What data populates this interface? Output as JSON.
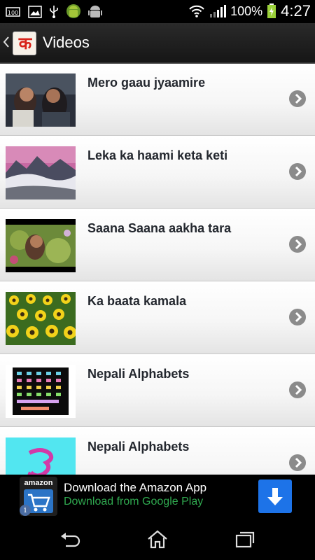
{
  "status_bar": {
    "battery_percent": "100%",
    "time": "4:27",
    "notification_icons": [
      "battery-100-icon",
      "image-icon",
      "usb-icon",
      "android-robot-icon",
      "android-debug-icon"
    ]
  },
  "action_bar": {
    "logo_char": "क",
    "title": "Videos"
  },
  "videos": [
    {
      "title": "Mero gaau jyaamire"
    },
    {
      "title": "Leka ka haami keta keti"
    },
    {
      "title": "Saana Saana aakha tara"
    },
    {
      "title": "Ka baata kamala"
    },
    {
      "title": "Nepali Alphabets"
    },
    {
      "title": "Nepali Alphabets"
    }
  ],
  "ad": {
    "brand": "amazon",
    "title": "Download the Amazon App",
    "subtitle": "Download from Google Play",
    "info": "i"
  },
  "colors": {
    "accent_green": "#2fa84f",
    "download_blue": "#1d73e8",
    "chevron_gray": "#8b8b8b",
    "logo_red": "#d8231a"
  }
}
